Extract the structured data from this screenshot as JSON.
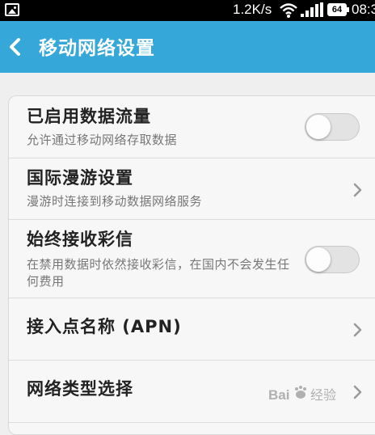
{
  "status_bar": {
    "network_speed": "1.2K/s",
    "battery_level": "64",
    "time": "08:3",
    "icons": [
      "image-notification-icon",
      "wifi-icon",
      "signal-icon",
      "battery-icon"
    ]
  },
  "app_bar": {
    "title": "移动网络设置",
    "back_icon": "chevron-left-icon",
    "background_color": "#35a7d9"
  },
  "settings": [
    {
      "title": "已启用数据流量",
      "subtitle": "允许通过移动网络存取数据",
      "control": "toggle",
      "checked": false
    },
    {
      "title": "国际漫游设置",
      "subtitle": "漫游时连接到移动数据网络服务",
      "control": "chevron"
    },
    {
      "title": "始终接收彩信",
      "subtitle": "在禁用数据时依然接收彩信，在国内不会发生任何费用",
      "control": "toggle",
      "checked": false
    },
    {
      "title": "接入点名称 (APN)",
      "control": "chevron"
    },
    {
      "title": "网络类型选择",
      "control": "chevron"
    }
  ],
  "watermark": {
    "text": "Baidu经验"
  }
}
